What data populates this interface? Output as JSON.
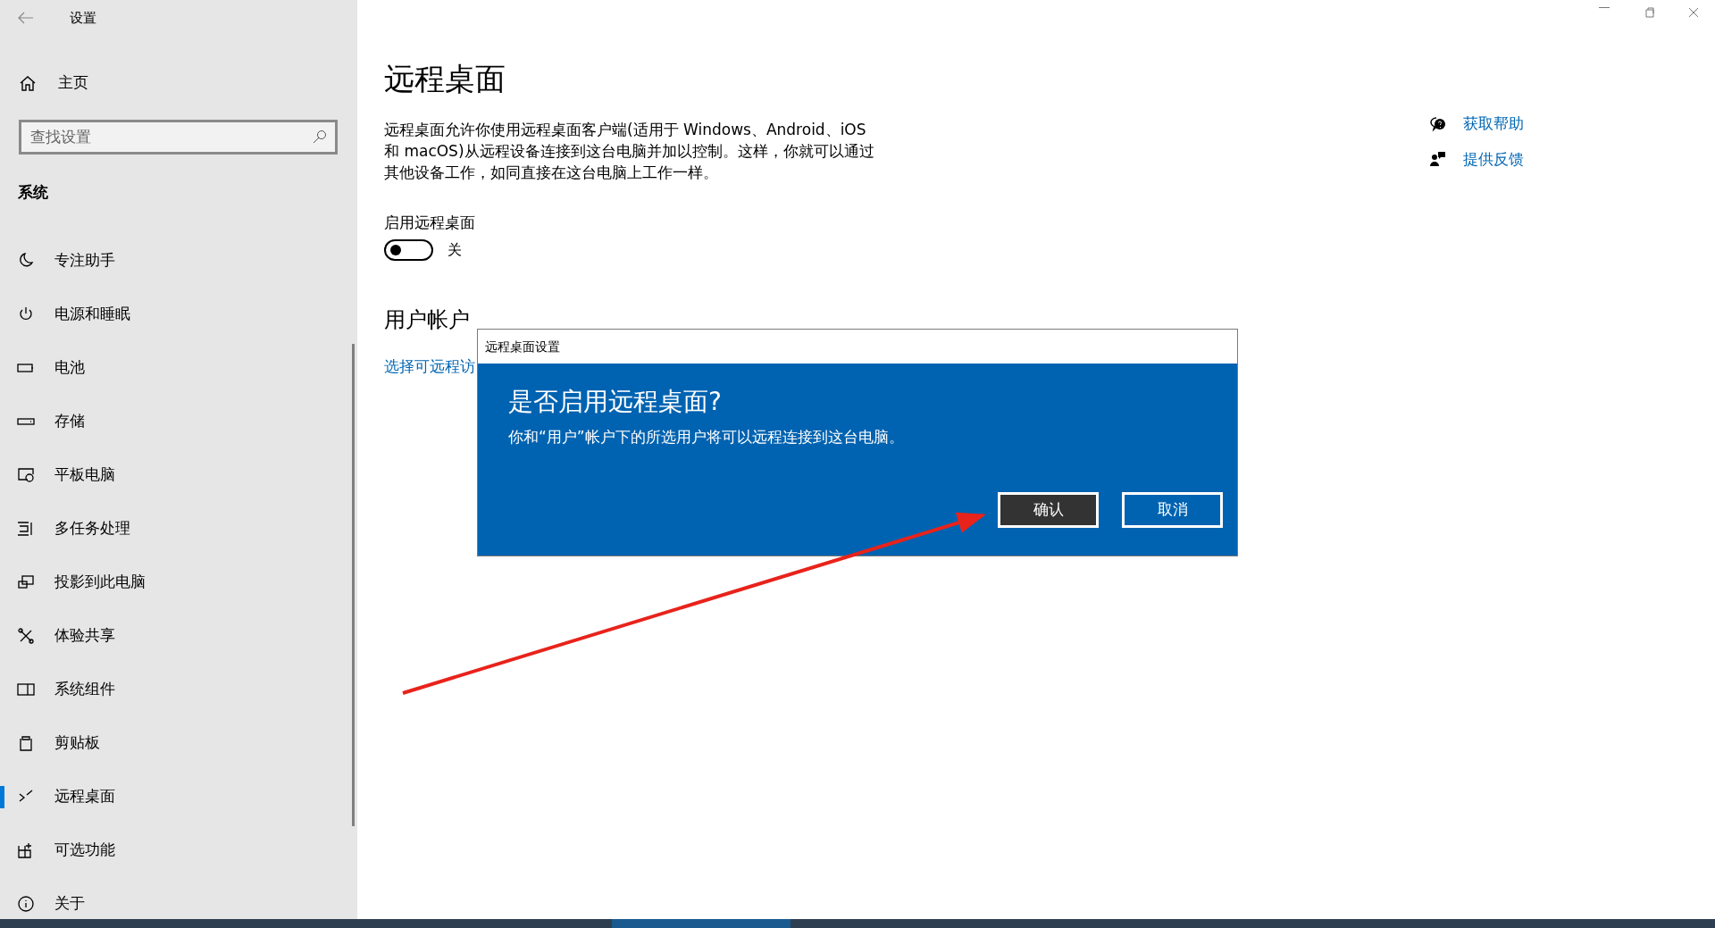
{
  "window": {
    "title": "设置"
  },
  "sidebar": {
    "home": "主页",
    "search": {
      "placeholder": "查找设置"
    },
    "section": "系统",
    "items": [
      {
        "label": "专注助手",
        "selected": false
      },
      {
        "label": "电源和睡眠",
        "selected": false
      },
      {
        "label": "电池",
        "selected": false
      },
      {
        "label": "存储",
        "selected": false
      },
      {
        "label": "平板电脑",
        "selected": false
      },
      {
        "label": "多任务处理",
        "selected": false
      },
      {
        "label": "投影到此电脑",
        "selected": false
      },
      {
        "label": "体验共享",
        "selected": false
      },
      {
        "label": "系统组件",
        "selected": false
      },
      {
        "label": "剪贴板",
        "selected": false
      },
      {
        "label": "远程桌面",
        "selected": true
      },
      {
        "label": "可选功能",
        "selected": false
      },
      {
        "label": "关于",
        "selected": false
      }
    ]
  },
  "main": {
    "title": "远程桌面",
    "description": "远程桌面允许你使用远程桌面客户端(适用于 Windows、Android、iOS 和 macOS)从远程设备连接到这台电脑并加以控制。这样，你就可以通过其他设备工作，如同直接在这台电脑上工作一样。",
    "toggle": {
      "label": "启用远程桌面",
      "on": false,
      "state_text": "关"
    },
    "section_title": "用户帐户",
    "link": "选择可远程访"
  },
  "help_links": [
    "获取帮助",
    "提供反馈"
  ],
  "dialog": {
    "title": "远程桌面设置",
    "heading": "是否启用远程桌面?",
    "message": "你和“用户”帐户下的所选用户将可以远程连接到这台电脑。",
    "buttons": [
      {
        "label": "确认",
        "selected": true
      },
      {
        "label": "取消",
        "selected": false
      }
    ]
  }
}
